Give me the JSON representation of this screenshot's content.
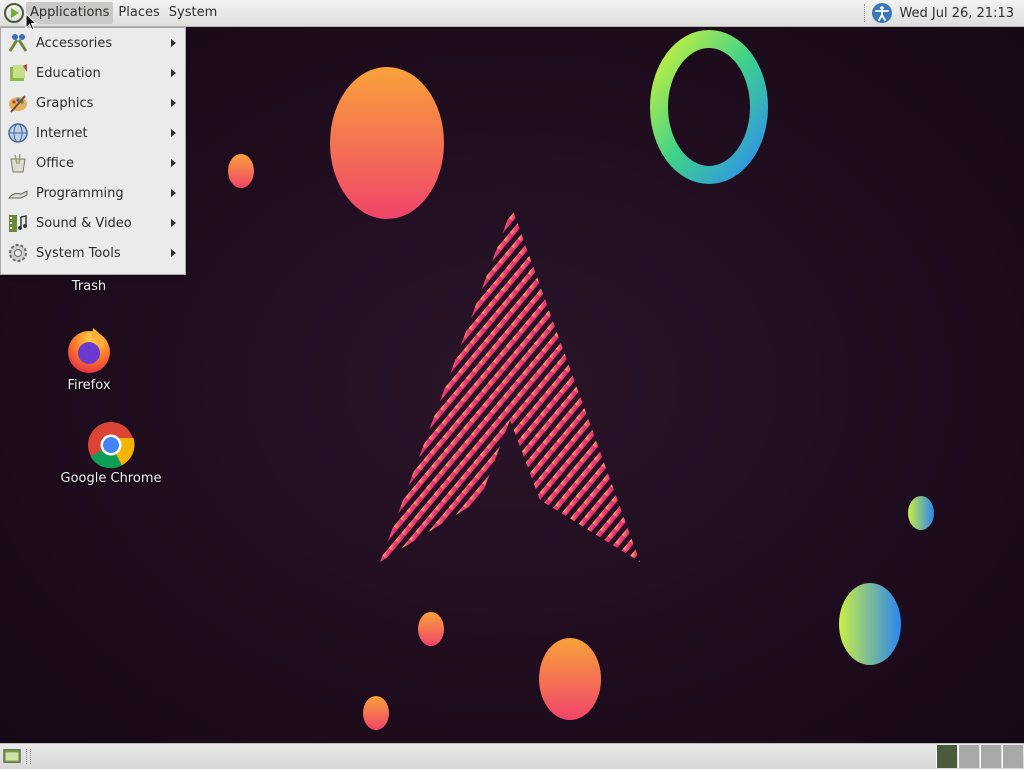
{
  "top_panel": {
    "menus": [
      "Applications",
      "Places",
      "System"
    ],
    "clock": "Wed Jul 26, 21:13",
    "icons": [
      "app-logo-icon",
      "accessibility-icon"
    ]
  },
  "app_menu": {
    "items": [
      {
        "label": "Accessories",
        "icon": "accessories-icon"
      },
      {
        "label": "Education",
        "icon": "education-icon"
      },
      {
        "label": "Graphics",
        "icon": "graphics-icon"
      },
      {
        "label": "Internet",
        "icon": "internet-icon"
      },
      {
        "label": "Office",
        "icon": "office-icon"
      },
      {
        "label": "Programming",
        "icon": "programming-icon"
      },
      {
        "label": "Sound & Video",
        "icon": "sound-video-icon"
      },
      {
        "label": "System Tools",
        "icon": "system-tools-icon"
      }
    ]
  },
  "desktop": {
    "icons": [
      {
        "label": "Trash",
        "icon": "trash-icon"
      },
      {
        "label": "Firefox",
        "icon": "firefox-icon"
      },
      {
        "label": "Google Chrome",
        "icon": "chrome-icon"
      }
    ]
  },
  "bottom_panel": {
    "icons": [
      "show-desktop-icon",
      "workspace-switcher"
    ],
    "workspace_count": 4,
    "active_workspace": 1
  },
  "colors": {
    "wallpaper": "#1a0b1a",
    "panel": "#e6e6e4",
    "menu": "#ebebeb",
    "accent_pink": "#e8206e",
    "accent_orange": "#f5983a"
  }
}
